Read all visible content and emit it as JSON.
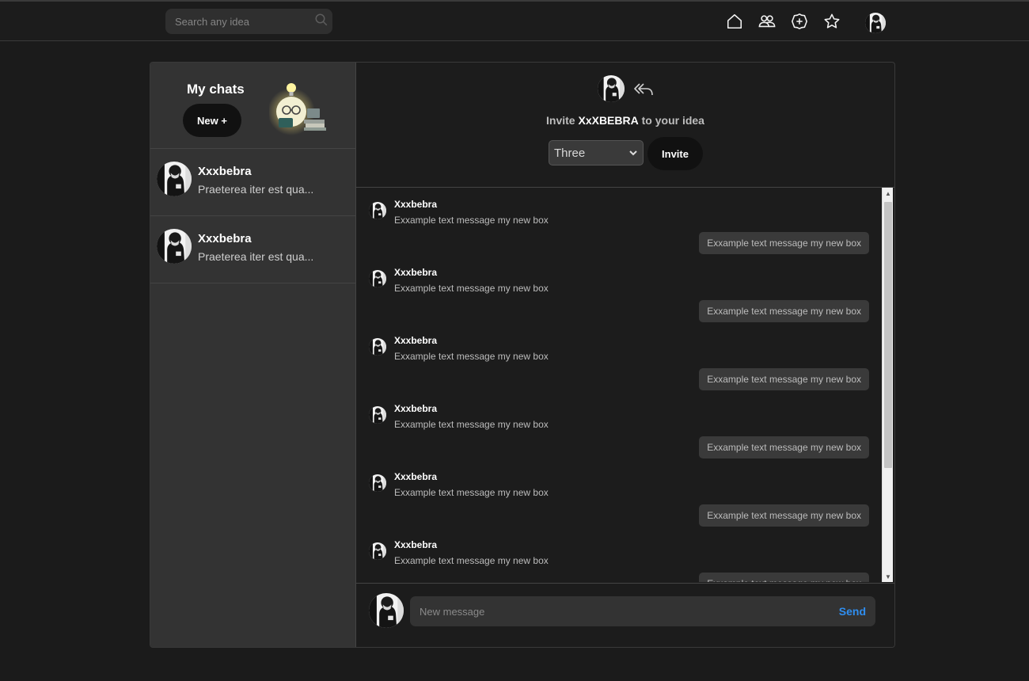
{
  "topbar": {
    "search_placeholder": "Search any idea",
    "nav_icons": [
      "home-icon",
      "users-icon",
      "add-circle-icon",
      "star-icon"
    ],
    "profile_avatar": "avatar"
  },
  "sidebar": {
    "title": "My chats",
    "new_button": "New +",
    "chats": [
      {
        "name": "Xxxbebra",
        "preview": "Praeterea iter est qua..."
      },
      {
        "name": "Xxxbebra",
        "preview": "Praeterea iter est qua..."
      }
    ]
  },
  "chat_header": {
    "invite_prefix": "Invite",
    "invite_user": "XxXBEBRA",
    "invite_suffix": "to your idea",
    "select_value": "Three",
    "invite_button": "Invite"
  },
  "messages": [
    {
      "type": "in",
      "name": "Xxxbebra",
      "text": "Exxample text message my new box"
    },
    {
      "type": "out",
      "text": "Exxample text message my new box"
    },
    {
      "type": "in",
      "name": "Xxxbebra",
      "text": "Exxample text message my new box"
    },
    {
      "type": "out",
      "text": "Exxample text message my new box"
    },
    {
      "type": "in",
      "name": "Xxxbebra",
      "text": "Exxample text message my new box"
    },
    {
      "type": "out",
      "text": "Exxample text message my new box"
    },
    {
      "type": "in",
      "name": "Xxxbebra",
      "text": "Exxample text message my new box"
    },
    {
      "type": "out",
      "text": "Exxample text message my new box"
    },
    {
      "type": "in",
      "name": "Xxxbebra",
      "text": "Exxample text message my new box"
    },
    {
      "type": "out",
      "text": "Exxample text message my new box"
    },
    {
      "type": "in",
      "name": "Xxxbebra",
      "text": "Exxample text message my new box"
    },
    {
      "type": "out",
      "text": "Exxample text message my new box"
    }
  ],
  "composer": {
    "placeholder": "New message",
    "send_label": "Send"
  },
  "colors": {
    "background": "#1b1b1b",
    "sidebar": "#333333",
    "accent": "#2f8ef0",
    "button": "#111111"
  }
}
